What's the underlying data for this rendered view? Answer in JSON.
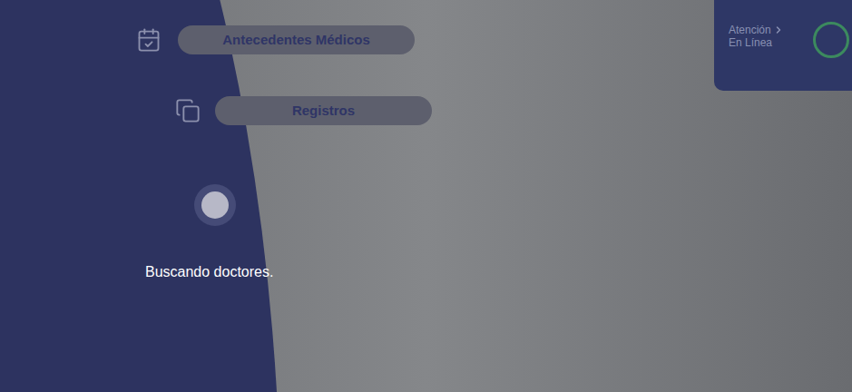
{
  "menu": [
    {
      "label": "Antecedentes Médicos",
      "kind": "calendar"
    },
    {
      "label": "Registros",
      "kind": "copy"
    }
  ],
  "loading": {
    "text": "Buscando doctores."
  },
  "online_card": {
    "title": "Atención",
    "subtitle": "En Línea"
  }
}
